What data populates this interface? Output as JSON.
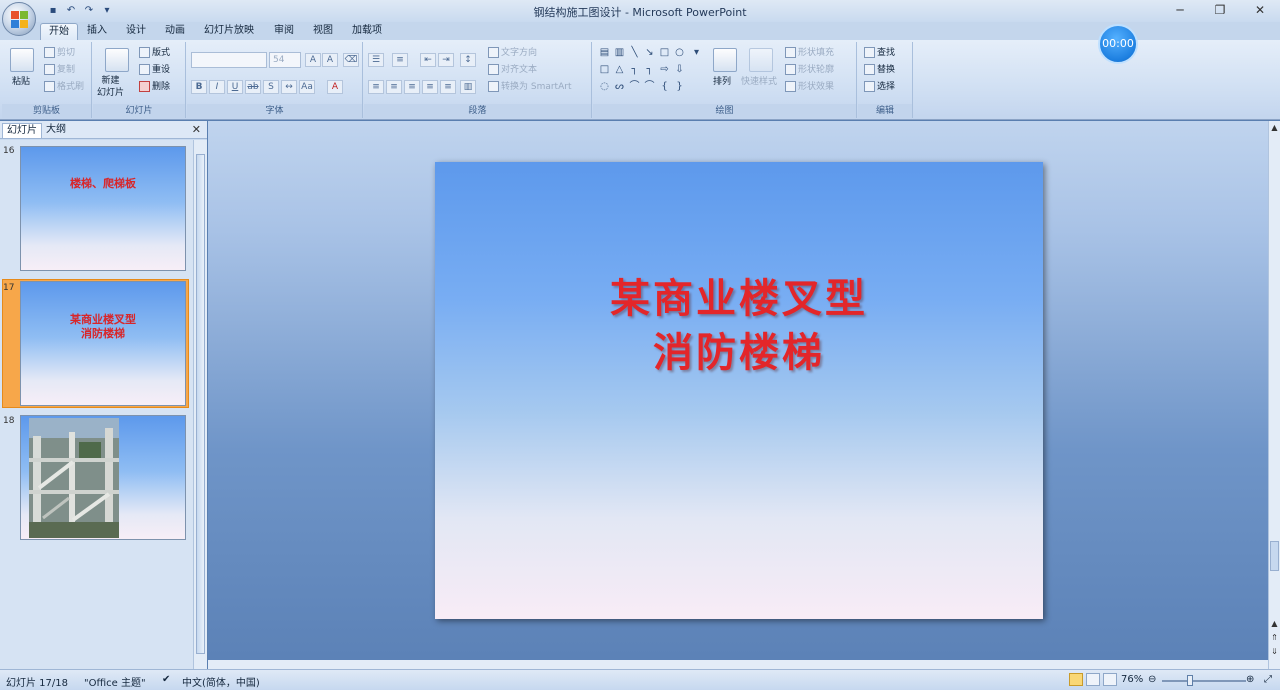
{
  "window": {
    "title": "钢结构施工图设计 - Microsoft PowerPoint",
    "controls": [
      "─",
      "❐",
      "✕"
    ]
  },
  "qat": {
    "icons": [
      "save-icon",
      "undo-icon",
      "redo-icon",
      "customize-icon"
    ],
    "glyphs": [
      "▪",
      "↶",
      "↷",
      "▾"
    ]
  },
  "timer": "00:00",
  "tabs": [
    "开始",
    "插入",
    "设计",
    "动画",
    "幻灯片放映",
    "审阅",
    "视图",
    "加载项"
  ],
  "ribbon": {
    "clipboard": {
      "label": "剪贴板",
      "paste": "粘贴",
      "cut": "剪切",
      "copy": "复制",
      "format_painter": "格式刷"
    },
    "slides": {
      "label": "幻灯片",
      "new_slide": "新建\n幻灯片",
      "layout": "版式",
      "reset": "重设",
      "delete": "删除"
    },
    "font": {
      "label": "字体",
      "size": "54"
    },
    "paragraph": {
      "label": "段落",
      "text_direction": "文字方向",
      "align_text": "对齐文本",
      "smartart": "转换为 SmartArt"
    },
    "drawing": {
      "label": "绘图",
      "arrange": "排列",
      "quick_styles": "快速样式",
      "shape_fill": "形状填充",
      "shape_outline": "形状轮廓",
      "shape_effects": "形状效果"
    },
    "editing": {
      "label": "编辑",
      "find": "查找",
      "replace": "替换",
      "select": "选择"
    }
  },
  "panel": {
    "tab_slides": "幻灯片",
    "tab_outline": "大纲",
    "close": "✕",
    "thumbnails": [
      {
        "number": "16",
        "text": "楼梯、爬梯板"
      },
      {
        "number": "17",
        "text": "某商业楼叉型\n消防楼梯",
        "selected": true
      },
      {
        "number": "18",
        "text": ""
      }
    ]
  },
  "slide": {
    "title_line1": "某商业楼叉型",
    "title_line2": "消防楼梯"
  },
  "status": {
    "slide_info": "幻灯片 17/18",
    "theme": "\"Office 主题\"",
    "language": "中文(简体，中国)",
    "zoom": "76%"
  }
}
